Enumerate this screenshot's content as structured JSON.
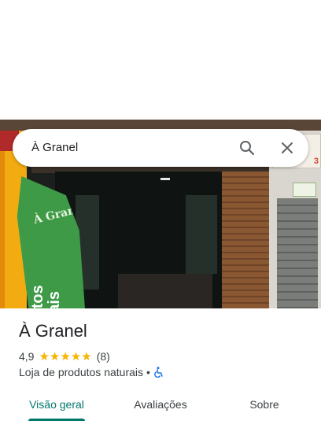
{
  "search": {
    "query": "À Granel",
    "search_icon": "search-icon",
    "close_icon": "close-icon"
  },
  "photo": {
    "banner_brand": "À Granel",
    "banner_text_line1": "Produtos",
    "banner_text_line2": "Naturais",
    "neighbor_number": "3"
  },
  "place": {
    "name": "À Granel",
    "rating": "4,9",
    "stars": "★★★★★",
    "review_count": "(8)",
    "category": "Loja de produtos naturais",
    "separator": "•",
    "accessibility_icon": "wheelchair-icon"
  },
  "tabs": [
    {
      "label": "Visão geral",
      "active": true
    },
    {
      "label": "Avaliações",
      "active": false
    },
    {
      "label": "Sobre",
      "active": false
    }
  ],
  "colors": {
    "accent": "#00796b",
    "star": "#f6b400",
    "accessibility": "#1a73e8"
  }
}
